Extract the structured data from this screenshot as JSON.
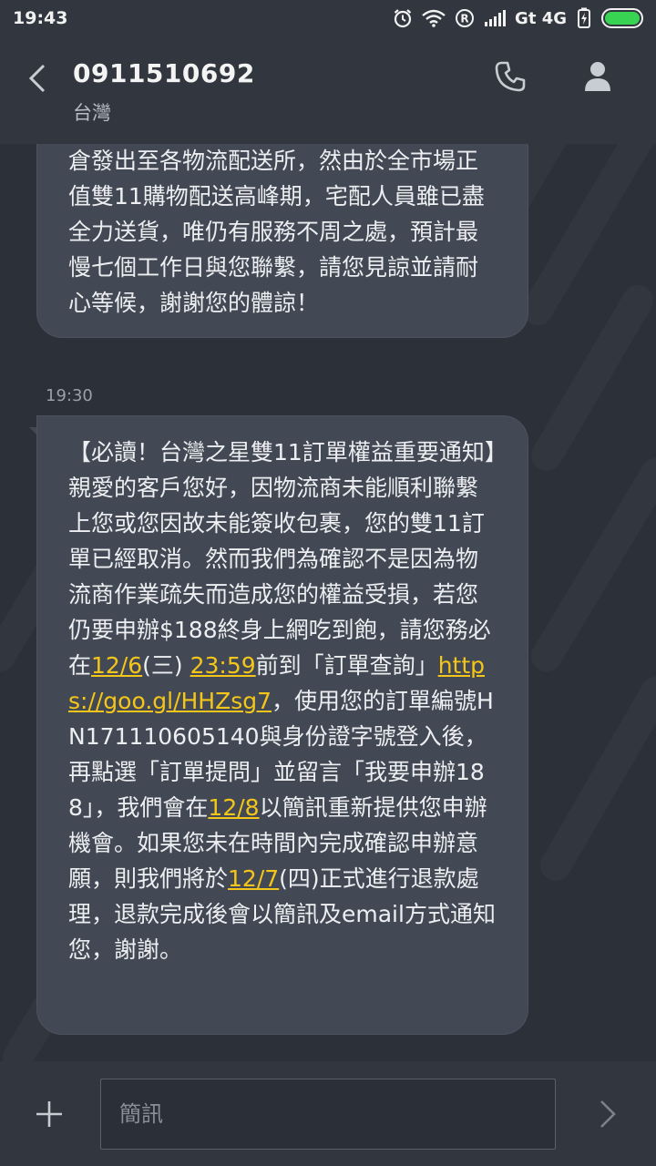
{
  "status_bar": {
    "time": "19:43",
    "network_label": "Gt 4G",
    "icons": [
      "alarm-icon",
      "wifi-icon",
      "roaming-icon",
      "signal-icon",
      "battery-saver-icon",
      "battery-icon"
    ],
    "battery_color": "#39d353"
  },
  "header": {
    "contact_number": "0911510692",
    "contact_region": "台灣",
    "icons": [
      "back-arrow-icon",
      "phone-icon",
      "person-icon"
    ]
  },
  "messages": [
    {
      "parts": [
        {
          "text": "倉發出至各物流配送所，然由於全市場正值雙11購物配送高峰期，宅配人員雖已盡全力送貨，唯仍有服務不周之處，預計最慢七個工作日與您聯繫，請您見諒並請耐心等候，謝謝您的體諒！"
        }
      ]
    },
    {
      "timestamp": "19:30",
      "parts": [
        {
          "text": "【必讀！台灣之星雙11訂單權益重要通知】親愛的客戶您好，因物流商未能順利聯繫上您或您因故未能簽收包裹，您的雙11訂單已經取消。然而我們為確認不是因為物流商作業疏失而造成您的權益受損，若您仍要申辦$188終身上網吃到飽，請您務必在"
        },
        {
          "text": "12/6",
          "link": true
        },
        {
          "text": "(三) "
        },
        {
          "text": "23:59",
          "link": true
        },
        {
          "text": "前到「訂單查詢」"
        },
        {
          "text": "https://goo.gl/HHZsg7",
          "link": true
        },
        {
          "text": "，使用您的訂單編號HN171110605140與身份證字號登入後，再點選「訂單提問」並留言「我要申辦188」，我們會在"
        },
        {
          "text": "12/8",
          "link": true
        },
        {
          "text": "以簡訊重新提供您申辦機會。如果您未在時間內完成確認申辦意願，則我們將於"
        },
        {
          "text": "12/7",
          "link": true
        },
        {
          "text": "(四)正式進行退款處理，退款完成後會以簡訊及email方式通知您，謝謝。"
        }
      ]
    }
  ],
  "colors": {
    "background": "#2b3039",
    "bar": "#31363f",
    "bubble": "#434954",
    "link": "#f4c619"
  },
  "compose": {
    "placeholder": "簡訊",
    "value": "",
    "icons": [
      "plus-icon",
      "send-chevron-icon"
    ]
  }
}
